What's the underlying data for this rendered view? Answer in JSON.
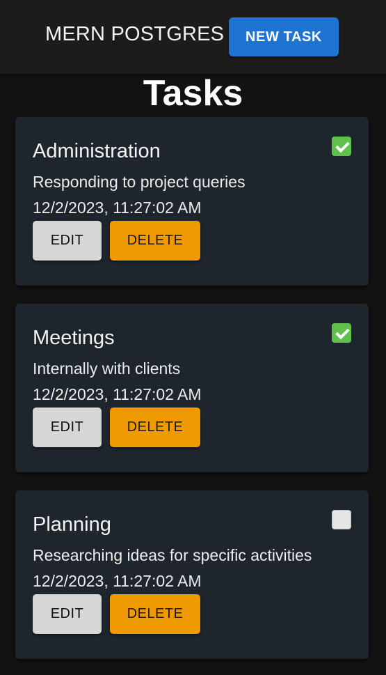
{
  "header": {
    "brand": "MERN POSTGRES",
    "new_task_label": "NEW TASK"
  },
  "page": {
    "title": "Tasks"
  },
  "tasks": [
    {
      "title": "Administration",
      "description": "Responding to project queries",
      "date": "12/2/2023, 11:27:02 AM",
      "done": true,
      "edit_label": "EDIT",
      "delete_label": "DELETE"
    },
    {
      "title": "Meetings",
      "description": "Internally with clients",
      "date": "12/2/2023, 11:27:02 AM",
      "done": true,
      "edit_label": "EDIT",
      "delete_label": "DELETE"
    },
    {
      "title": "Planning",
      "description": "Researching ideas for specific activities",
      "date": "12/2/2023, 11:27:02 AM",
      "done": false,
      "edit_label": "EDIT",
      "delete_label": "DELETE"
    }
  ],
  "colors": {
    "primary": "#1f74d1",
    "warning": "#ee9a00",
    "done": "#5fc04a"
  }
}
